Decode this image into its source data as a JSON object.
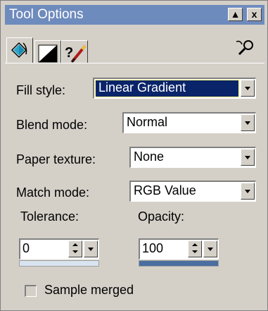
{
  "window": {
    "title": "Tool Options",
    "minimize_glyph": "▲",
    "close_glyph": "x"
  },
  "tabs": [
    {
      "name": "fill-tab",
      "icon": "paint-bucket-icon",
      "active": true
    },
    {
      "name": "gradient-tab",
      "icon": "gradient-icon",
      "active": false
    },
    {
      "name": "help-tab",
      "icon": "help-brush-icon",
      "active": false
    }
  ],
  "fields": {
    "fill_style": {
      "label": "Fill style:",
      "value": "Linear Gradient"
    },
    "blend_mode": {
      "label": "Blend mode:",
      "value": "Normal"
    },
    "paper_texture": {
      "label": "Paper texture:",
      "value": "None"
    },
    "match_mode": {
      "label": "Match mode:",
      "value": "RGB Value"
    },
    "tolerance": {
      "label": "Tolerance:",
      "value": "0"
    },
    "opacity": {
      "label": "Opacity:",
      "value": "100"
    },
    "sample_merged": {
      "label": "Sample merged",
      "checked": false
    }
  },
  "colors": {
    "titlebar": "#6e8bbd",
    "face": "#d4d0c8",
    "selection": "#0a246a"
  }
}
